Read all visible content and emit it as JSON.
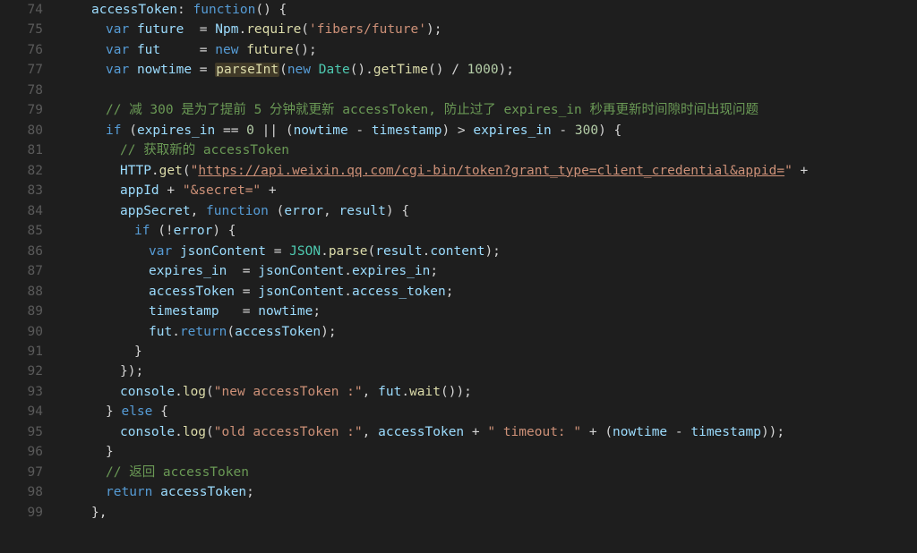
{
  "editor": {
    "language": "javascript",
    "lines": [
      {
        "n": 74,
        "indent": "i1",
        "tokens": [
          {
            "c": "prop",
            "t": "accessToken"
          },
          {
            "c": "op",
            "t": ": "
          },
          {
            "c": "k",
            "t": "function"
          },
          {
            "c": "op",
            "t": "() {"
          }
        ]
      },
      {
        "n": 75,
        "indent": "i2",
        "tokens": [
          {
            "c": "k",
            "t": "var"
          },
          {
            "c": "op",
            "t": " "
          },
          {
            "c": "prop",
            "t": "future"
          },
          {
            "c": "op",
            "t": "  = "
          },
          {
            "c": "prop",
            "t": "Npm"
          },
          {
            "c": "op",
            "t": "."
          },
          {
            "c": "fn",
            "t": "require"
          },
          {
            "c": "op",
            "t": "("
          },
          {
            "c": "str",
            "t": "'fibers/future'"
          },
          {
            "c": "op",
            "t": ");"
          }
        ]
      },
      {
        "n": 76,
        "indent": "i2",
        "tokens": [
          {
            "c": "k",
            "t": "var"
          },
          {
            "c": "op",
            "t": " "
          },
          {
            "c": "prop",
            "t": "fut"
          },
          {
            "c": "op",
            "t": "     = "
          },
          {
            "c": "k",
            "t": "new"
          },
          {
            "c": "op",
            "t": " "
          },
          {
            "c": "fn",
            "t": "future"
          },
          {
            "c": "op",
            "t": "();"
          }
        ]
      },
      {
        "n": 77,
        "indent": "i2",
        "tokens": [
          {
            "c": "k",
            "t": "var"
          },
          {
            "c": "op",
            "t": " "
          },
          {
            "c": "prop",
            "t": "nowtime"
          },
          {
            "c": "op",
            "t": " = "
          },
          {
            "c": "hlfn",
            "t": "parseInt"
          },
          {
            "c": "op",
            "t": "("
          },
          {
            "c": "k",
            "t": "new"
          },
          {
            "c": "op",
            "t": " "
          },
          {
            "c": "cls",
            "t": "Date"
          },
          {
            "c": "op",
            "t": "()."
          },
          {
            "c": "fn",
            "t": "getTime"
          },
          {
            "c": "op",
            "t": "() / "
          },
          {
            "c": "num",
            "t": "1000"
          },
          {
            "c": "op",
            "t": ");"
          }
        ]
      },
      {
        "n": 78,
        "indent": "",
        "tokens": []
      },
      {
        "n": 79,
        "indent": "i2",
        "tokens": [
          {
            "c": "cmt",
            "t": "// 减 300 是为了提前 5 分钟就更新 accessToken, 防止过了 expires_in 秒再更新时间隙时间出现问题"
          }
        ]
      },
      {
        "n": 80,
        "indent": "i2",
        "tokens": [
          {
            "c": "k",
            "t": "if"
          },
          {
            "c": "op",
            "t": " ("
          },
          {
            "c": "prop",
            "t": "expires_in"
          },
          {
            "c": "op",
            "t": " == "
          },
          {
            "c": "num",
            "t": "0"
          },
          {
            "c": "op",
            "t": " || ("
          },
          {
            "c": "prop",
            "t": "nowtime"
          },
          {
            "c": "op",
            "t": " - "
          },
          {
            "c": "prop",
            "t": "timestamp"
          },
          {
            "c": "op",
            "t": ") > "
          },
          {
            "c": "prop",
            "t": "expires_in"
          },
          {
            "c": "op",
            "t": " - "
          },
          {
            "c": "num",
            "t": "300"
          },
          {
            "c": "op",
            "t": ") {"
          }
        ]
      },
      {
        "n": 81,
        "indent": "i3",
        "tokens": [
          {
            "c": "cmt",
            "t": "// 获取新的 accessToken"
          }
        ]
      },
      {
        "n": 82,
        "indent": "i3",
        "tokens": [
          {
            "c": "prop",
            "t": "HTTP"
          },
          {
            "c": "op",
            "t": "."
          },
          {
            "c": "fn",
            "t": "get"
          },
          {
            "c": "op",
            "t": "("
          },
          {
            "c": "str",
            "t": "\""
          },
          {
            "c": "url",
            "t": "https://api.weixin.qq.com/cgi-bin/token?grant_type=client_credential&appid="
          },
          {
            "c": "str",
            "t": "\""
          },
          {
            "c": "op",
            "t": " +"
          }
        ]
      },
      {
        "n": 83,
        "indent": "i3",
        "tokens": [
          {
            "c": "prop",
            "t": "appId"
          },
          {
            "c": "op",
            "t": " + "
          },
          {
            "c": "str",
            "t": "\"&secret=\""
          },
          {
            "c": "op",
            "t": " +"
          }
        ]
      },
      {
        "n": 84,
        "indent": "i3",
        "tokens": [
          {
            "c": "prop",
            "t": "appSecret"
          },
          {
            "c": "op",
            "t": ", "
          },
          {
            "c": "k",
            "t": "function"
          },
          {
            "c": "op",
            "t": " ("
          },
          {
            "c": "prop",
            "t": "error"
          },
          {
            "c": "op",
            "t": ", "
          },
          {
            "c": "prop",
            "t": "result"
          },
          {
            "c": "op",
            "t": ") {"
          }
        ]
      },
      {
        "n": 85,
        "indent": "i4",
        "tokens": [
          {
            "c": "k",
            "t": "if"
          },
          {
            "c": "op",
            "t": " (!"
          },
          {
            "c": "prop",
            "t": "error"
          },
          {
            "c": "op",
            "t": ") {"
          }
        ]
      },
      {
        "n": 86,
        "indent": "i5",
        "tokens": [
          {
            "c": "k",
            "t": "var"
          },
          {
            "c": "op",
            "t": " "
          },
          {
            "c": "prop",
            "t": "jsonContent"
          },
          {
            "c": "op",
            "t": " = "
          },
          {
            "c": "cls",
            "t": "JSON"
          },
          {
            "c": "op",
            "t": "."
          },
          {
            "c": "fn",
            "t": "parse"
          },
          {
            "c": "op",
            "t": "("
          },
          {
            "c": "prop",
            "t": "result"
          },
          {
            "c": "op",
            "t": "."
          },
          {
            "c": "prop",
            "t": "content"
          },
          {
            "c": "op",
            "t": ");"
          }
        ]
      },
      {
        "n": 87,
        "indent": "i5",
        "tokens": [
          {
            "c": "prop",
            "t": "expires_in"
          },
          {
            "c": "op",
            "t": "  = "
          },
          {
            "c": "prop",
            "t": "jsonContent"
          },
          {
            "c": "op",
            "t": "."
          },
          {
            "c": "prop",
            "t": "expires_in"
          },
          {
            "c": "op",
            "t": ";"
          }
        ]
      },
      {
        "n": 88,
        "indent": "i5",
        "tokens": [
          {
            "c": "prop",
            "t": "accessToken"
          },
          {
            "c": "op",
            "t": " = "
          },
          {
            "c": "prop",
            "t": "jsonContent"
          },
          {
            "c": "op",
            "t": "."
          },
          {
            "c": "prop",
            "t": "access_token"
          },
          {
            "c": "op",
            "t": ";"
          }
        ]
      },
      {
        "n": 89,
        "indent": "i5",
        "tokens": [
          {
            "c": "prop",
            "t": "timestamp"
          },
          {
            "c": "op",
            "t": "   = "
          },
          {
            "c": "prop",
            "t": "nowtime"
          },
          {
            "c": "op",
            "t": ";"
          }
        ]
      },
      {
        "n": 90,
        "indent": "i5",
        "tokens": [
          {
            "c": "prop",
            "t": "fut"
          },
          {
            "c": "op",
            "t": "."
          },
          {
            "c": "k",
            "t": "return"
          },
          {
            "c": "op",
            "t": "("
          },
          {
            "c": "prop",
            "t": "accessToken"
          },
          {
            "c": "op",
            "t": ");"
          }
        ]
      },
      {
        "n": 91,
        "indent": "i4",
        "tokens": [
          {
            "c": "op",
            "t": "}"
          }
        ]
      },
      {
        "n": 92,
        "indent": "i3",
        "tokens": [
          {
            "c": "op",
            "t": "});"
          }
        ]
      },
      {
        "n": 93,
        "indent": "i3",
        "tokens": [
          {
            "c": "prop",
            "t": "console"
          },
          {
            "c": "op",
            "t": "."
          },
          {
            "c": "fn",
            "t": "log"
          },
          {
            "c": "op",
            "t": "("
          },
          {
            "c": "str",
            "t": "\"new accessToken :\""
          },
          {
            "c": "op",
            "t": ", "
          },
          {
            "c": "prop",
            "t": "fut"
          },
          {
            "c": "op",
            "t": "."
          },
          {
            "c": "fn",
            "t": "wait"
          },
          {
            "c": "op",
            "t": "());"
          }
        ]
      },
      {
        "n": 94,
        "indent": "i2",
        "tokens": [
          {
            "c": "op",
            "t": "} "
          },
          {
            "c": "k",
            "t": "else"
          },
          {
            "c": "op",
            "t": " {"
          }
        ]
      },
      {
        "n": 95,
        "indent": "i3",
        "tokens": [
          {
            "c": "prop",
            "t": "console"
          },
          {
            "c": "op",
            "t": "."
          },
          {
            "c": "fn",
            "t": "log"
          },
          {
            "c": "op",
            "t": "("
          },
          {
            "c": "str",
            "t": "\"old accessToken :\""
          },
          {
            "c": "op",
            "t": ", "
          },
          {
            "c": "prop",
            "t": "accessToken"
          },
          {
            "c": "op",
            "t": " + "
          },
          {
            "c": "str",
            "t": "\" timeout: \""
          },
          {
            "c": "op",
            "t": " + ("
          },
          {
            "c": "prop",
            "t": "nowtime"
          },
          {
            "c": "op",
            "t": " - "
          },
          {
            "c": "prop",
            "t": "timestamp"
          },
          {
            "c": "op",
            "t": "));"
          }
        ]
      },
      {
        "n": 96,
        "indent": "i2",
        "tokens": [
          {
            "c": "op",
            "t": "}"
          }
        ]
      },
      {
        "n": 97,
        "indent": "i2",
        "tokens": [
          {
            "c": "cmt",
            "t": "// 返回 accessToken"
          }
        ]
      },
      {
        "n": 98,
        "indent": "i2",
        "tokens": [
          {
            "c": "k",
            "t": "return"
          },
          {
            "c": "op",
            "t": " "
          },
          {
            "c": "prop",
            "t": "accessToken"
          },
          {
            "c": "op",
            "t": ";"
          }
        ]
      },
      {
        "n": 99,
        "indent": "i1",
        "tokens": [
          {
            "c": "op",
            "t": "},"
          }
        ]
      }
    ]
  }
}
